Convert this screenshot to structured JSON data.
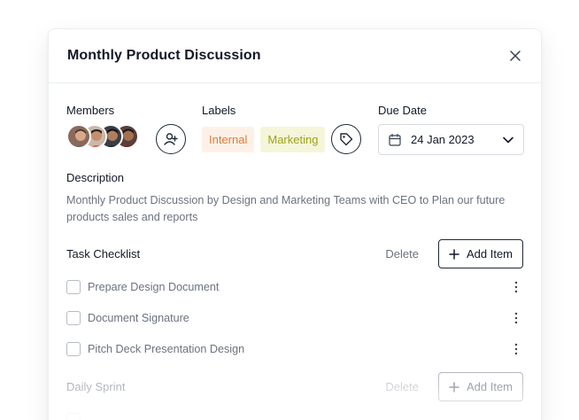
{
  "modal": {
    "title": "Monthly Product Discussion"
  },
  "members": {
    "label": "Members",
    "avatars": [
      "avatar-1",
      "avatar-2",
      "avatar-3",
      "avatar-4"
    ],
    "add_icon": "add-user-icon"
  },
  "labels": {
    "label": "Labels",
    "tags": [
      {
        "text": "Internal",
        "color": "#e07b39",
        "bg": "#fdf1e7"
      },
      {
        "text": "Marketing",
        "color": "#9aa21d",
        "bg": "#f5f6d9"
      }
    ],
    "tag_icon": "tag-icon"
  },
  "due_date": {
    "label": "Due Date",
    "value": "24 Jan 2023"
  },
  "description": {
    "label": "Description",
    "text": "Monthly Product Discussion by Design and Marketing Teams with CEO to Plan our future products sales and reports"
  },
  "task_checklist": {
    "title": "Task Checklist",
    "delete_label": "Delete",
    "add_label": "Add Item",
    "items": [
      {
        "label": "Prepare Design Document",
        "checked": false
      },
      {
        "label": "Document Signature",
        "checked": false
      },
      {
        "label": "Pitch Deck Presentation Design",
        "checked": false
      }
    ]
  },
  "daily_sprint": {
    "title": "Daily Sprint",
    "delete_label": "Delete",
    "add_label": "Add Item"
  }
}
